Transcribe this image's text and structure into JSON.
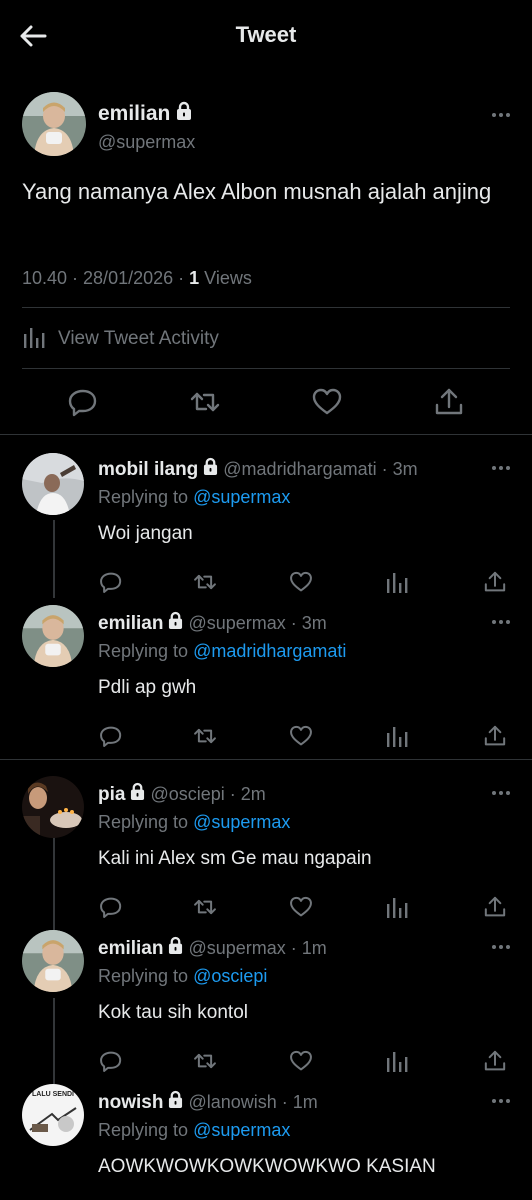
{
  "header": {
    "title": "Tweet"
  },
  "main_tweet": {
    "name": "emilian",
    "handle": "@supermax",
    "text": "Yang namanya Alex Albon musnah ajalah anjing",
    "time": "10.40 · 28/01/2026 · ",
    "views_count": "1",
    "views_label": " Views",
    "activity_label": "View Tweet Activity"
  },
  "replies": [
    {
      "name": "mobil ilang",
      "meta": "@madridhargamati · 3m",
      "replying_prefix": "Replying to ",
      "replying_to": "@supermax",
      "text": "Woi jangan"
    },
    {
      "name": "emilian",
      "meta": "@supermax · 3m",
      "replying_prefix": "Replying to ",
      "replying_to": "@madridhargamati",
      "text": "Pdli ap gwh"
    },
    {
      "name": "pia",
      "meta": "@osciepi · 2m",
      "replying_prefix": "Replying to ",
      "replying_to": "@supermax",
      "text": "Kali ini Alex sm Ge mau ngapain"
    },
    {
      "name": "emilian",
      "meta": "@supermax · 1m",
      "replying_prefix": "Replying to ",
      "replying_to": "@osciepi",
      "text": "Kok tau sih kontol"
    },
    {
      "name": "nowish",
      "meta": "@lanowish · 1m",
      "replying_prefix": "Replying to ",
      "replying_to": "@supermax",
      "text": "AOWKWOWKOWKWOWKWO KASIAN",
      "avatar_text": "LALU SENDI"
    }
  ],
  "colors": {
    "background": "#000000",
    "text": "#e7e9ea",
    "secondary": "#71767b",
    "link": "#1d9bf0",
    "divider": "#2f3336"
  }
}
